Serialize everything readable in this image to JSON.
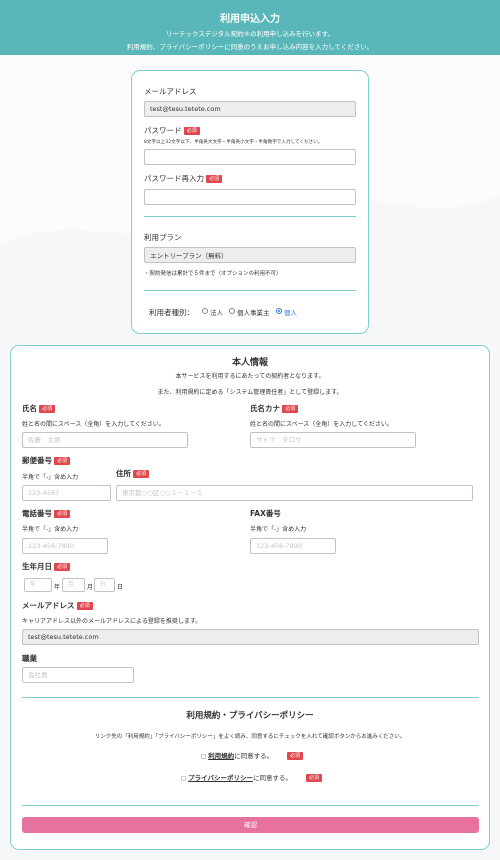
{
  "header": {
    "title": "利用申込入力",
    "sub1": "リーテックスデジタル契約®の利用申し込みを行います。",
    "sub2": "利用規約、プライバシーポリシーに同意のうえお申し込み内容を入力してください。",
    "bg_color": "#5ab7b9"
  },
  "account": {
    "email_label": "メールアドレス",
    "email_value": "test@tesu.tetete.com",
    "password_label": "パスワード",
    "required_badge": "必須",
    "password_hint": "8文字以上32文字以下、半角英大文字・半角英小文字・半角数字で入力してください。",
    "password_confirm_label": "パスワード再入力",
    "plan_label": "利用プラン",
    "plan_value": "エントリープラン（無料）",
    "plan_note": "・契約発信は累計で５件まで（オプションの利用不可）",
    "user_type_label": "利用者種別：",
    "user_types": [
      "法人",
      "個人事業主",
      "個人"
    ],
    "user_type_selected": "個人"
  },
  "profile": {
    "title": "本人情報",
    "desc1": "本サービスを利用するにあたっての契約者となります。",
    "desc2": "また、利用規約に定める「システム管理責任者」として登録します。",
    "name_label": "氏名",
    "name_hint": "姓と名の間にスペース（全角）を入力してください。",
    "name_placeholder": "佐藤　太郎",
    "kana_label": "氏名カナ",
    "kana_hint": "姓と名の間にスペース（全角）を入力してください。",
    "kana_placeholder": "サトウ　タロウ",
    "postal_label": "郵便番号",
    "postal_hint": "半角で「-」含め入力",
    "postal_placeholder": "123-4567",
    "address_label": "住所",
    "address_placeholder": "東京都○○区○○１－１－１",
    "phone_label": "電話番号",
    "phone_hint": "半角で「-」含め入力",
    "phone_placeholder": "123-456-7890",
    "fax_label": "FAX番号",
    "fax_hint": "半角で「-」含め入力",
    "fax_placeholder": "123-456-7890",
    "birth_label": "生年月日",
    "birth_year_placeholder": "年",
    "birth_year_unit": "年",
    "birth_month_placeholder": "月",
    "birth_month_unit": "月",
    "birth_day_placeholder": "日",
    "birth_day_unit": "日",
    "email_label": "メールアドレス",
    "email_hint": "キャリアアドレス以外のメールアドレスによる登録を推奨します。",
    "email_value": "test@tesu.tetete.com",
    "job_label": "職業",
    "job_placeholder": "会社員",
    "required_badge": "必須"
  },
  "terms": {
    "title": "利用規約・プライバシーポリシー",
    "desc": "リンク先の「利用規約」「プライバシーポリシー」をよく読み、同意するにチェックを入れて確認ボタンからお進みください。",
    "terms_link": "利用規約",
    "terms_suffix": "に同意する。",
    "privacy_link": "プライバシーポリシー",
    "privacy_suffix": "に同意する。",
    "required_badge": "必須"
  },
  "confirm_button": "確認",
  "colors": {
    "accent": "#7fcfd0",
    "button": "#e7729f",
    "badge": "#e0464b"
  }
}
